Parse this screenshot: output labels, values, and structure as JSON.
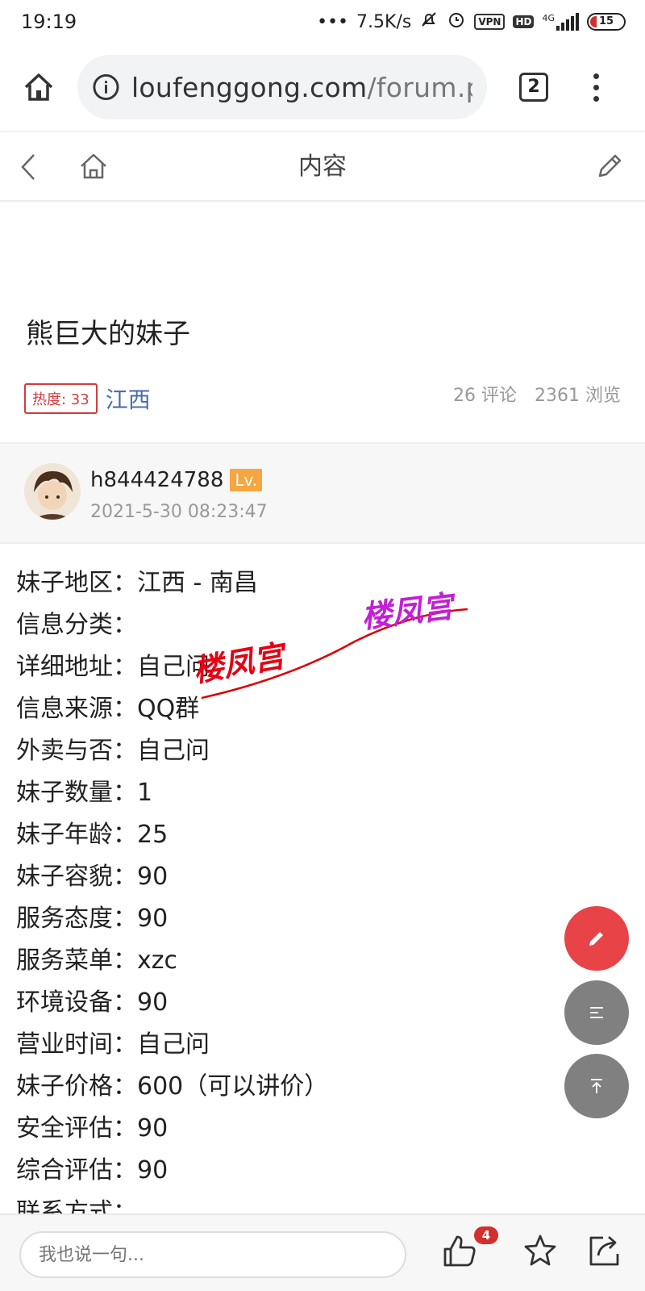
{
  "status_bar": {
    "time": "19:19",
    "speed": "7.5K/s",
    "vpn": "VPN",
    "hd": "HD",
    "network": "4G",
    "battery": "15"
  },
  "browser": {
    "url_domain": "loufenggong.com",
    "url_path": "/forum.p",
    "tab_count": "2"
  },
  "header": {
    "title": "内容"
  },
  "post": {
    "title": "熊巨大的妹子",
    "heat": "热度: 33",
    "region": "江西",
    "comments": "26 评论",
    "views": "2361 浏览"
  },
  "author": {
    "name": "h844424788",
    "level": "Lv.",
    "date": "2021-5-30 08:23:47"
  },
  "content_lines": [
    "妹子地区：江西 - 南昌",
    "信息分类：",
    "详细地址：自己问",
    "信息来源：QQ群",
    "外卖与否：自己问",
    "妹子数量：1",
    "妹子年龄：25",
    "妹子容貌：90",
    "服务态度：90",
    "服务菜单：xzc",
    "环境设备：90",
    "营业时间：自己问",
    "妹子价格：600（可以讲价）",
    "安全评估：90",
    "综合评估：90",
    "联系方式："
  ],
  "watermark": {
    "text1": "楼凤宫",
    "text2": "楼凤宫"
  },
  "bottom": {
    "placeholder": "我也说一句...",
    "like_count": "4"
  },
  "colors": {
    "accent_red": "#e84346",
    "heat_red": "#d23c3c",
    "region_blue": "#4a6ea6",
    "level_orange": "#f4a640"
  }
}
